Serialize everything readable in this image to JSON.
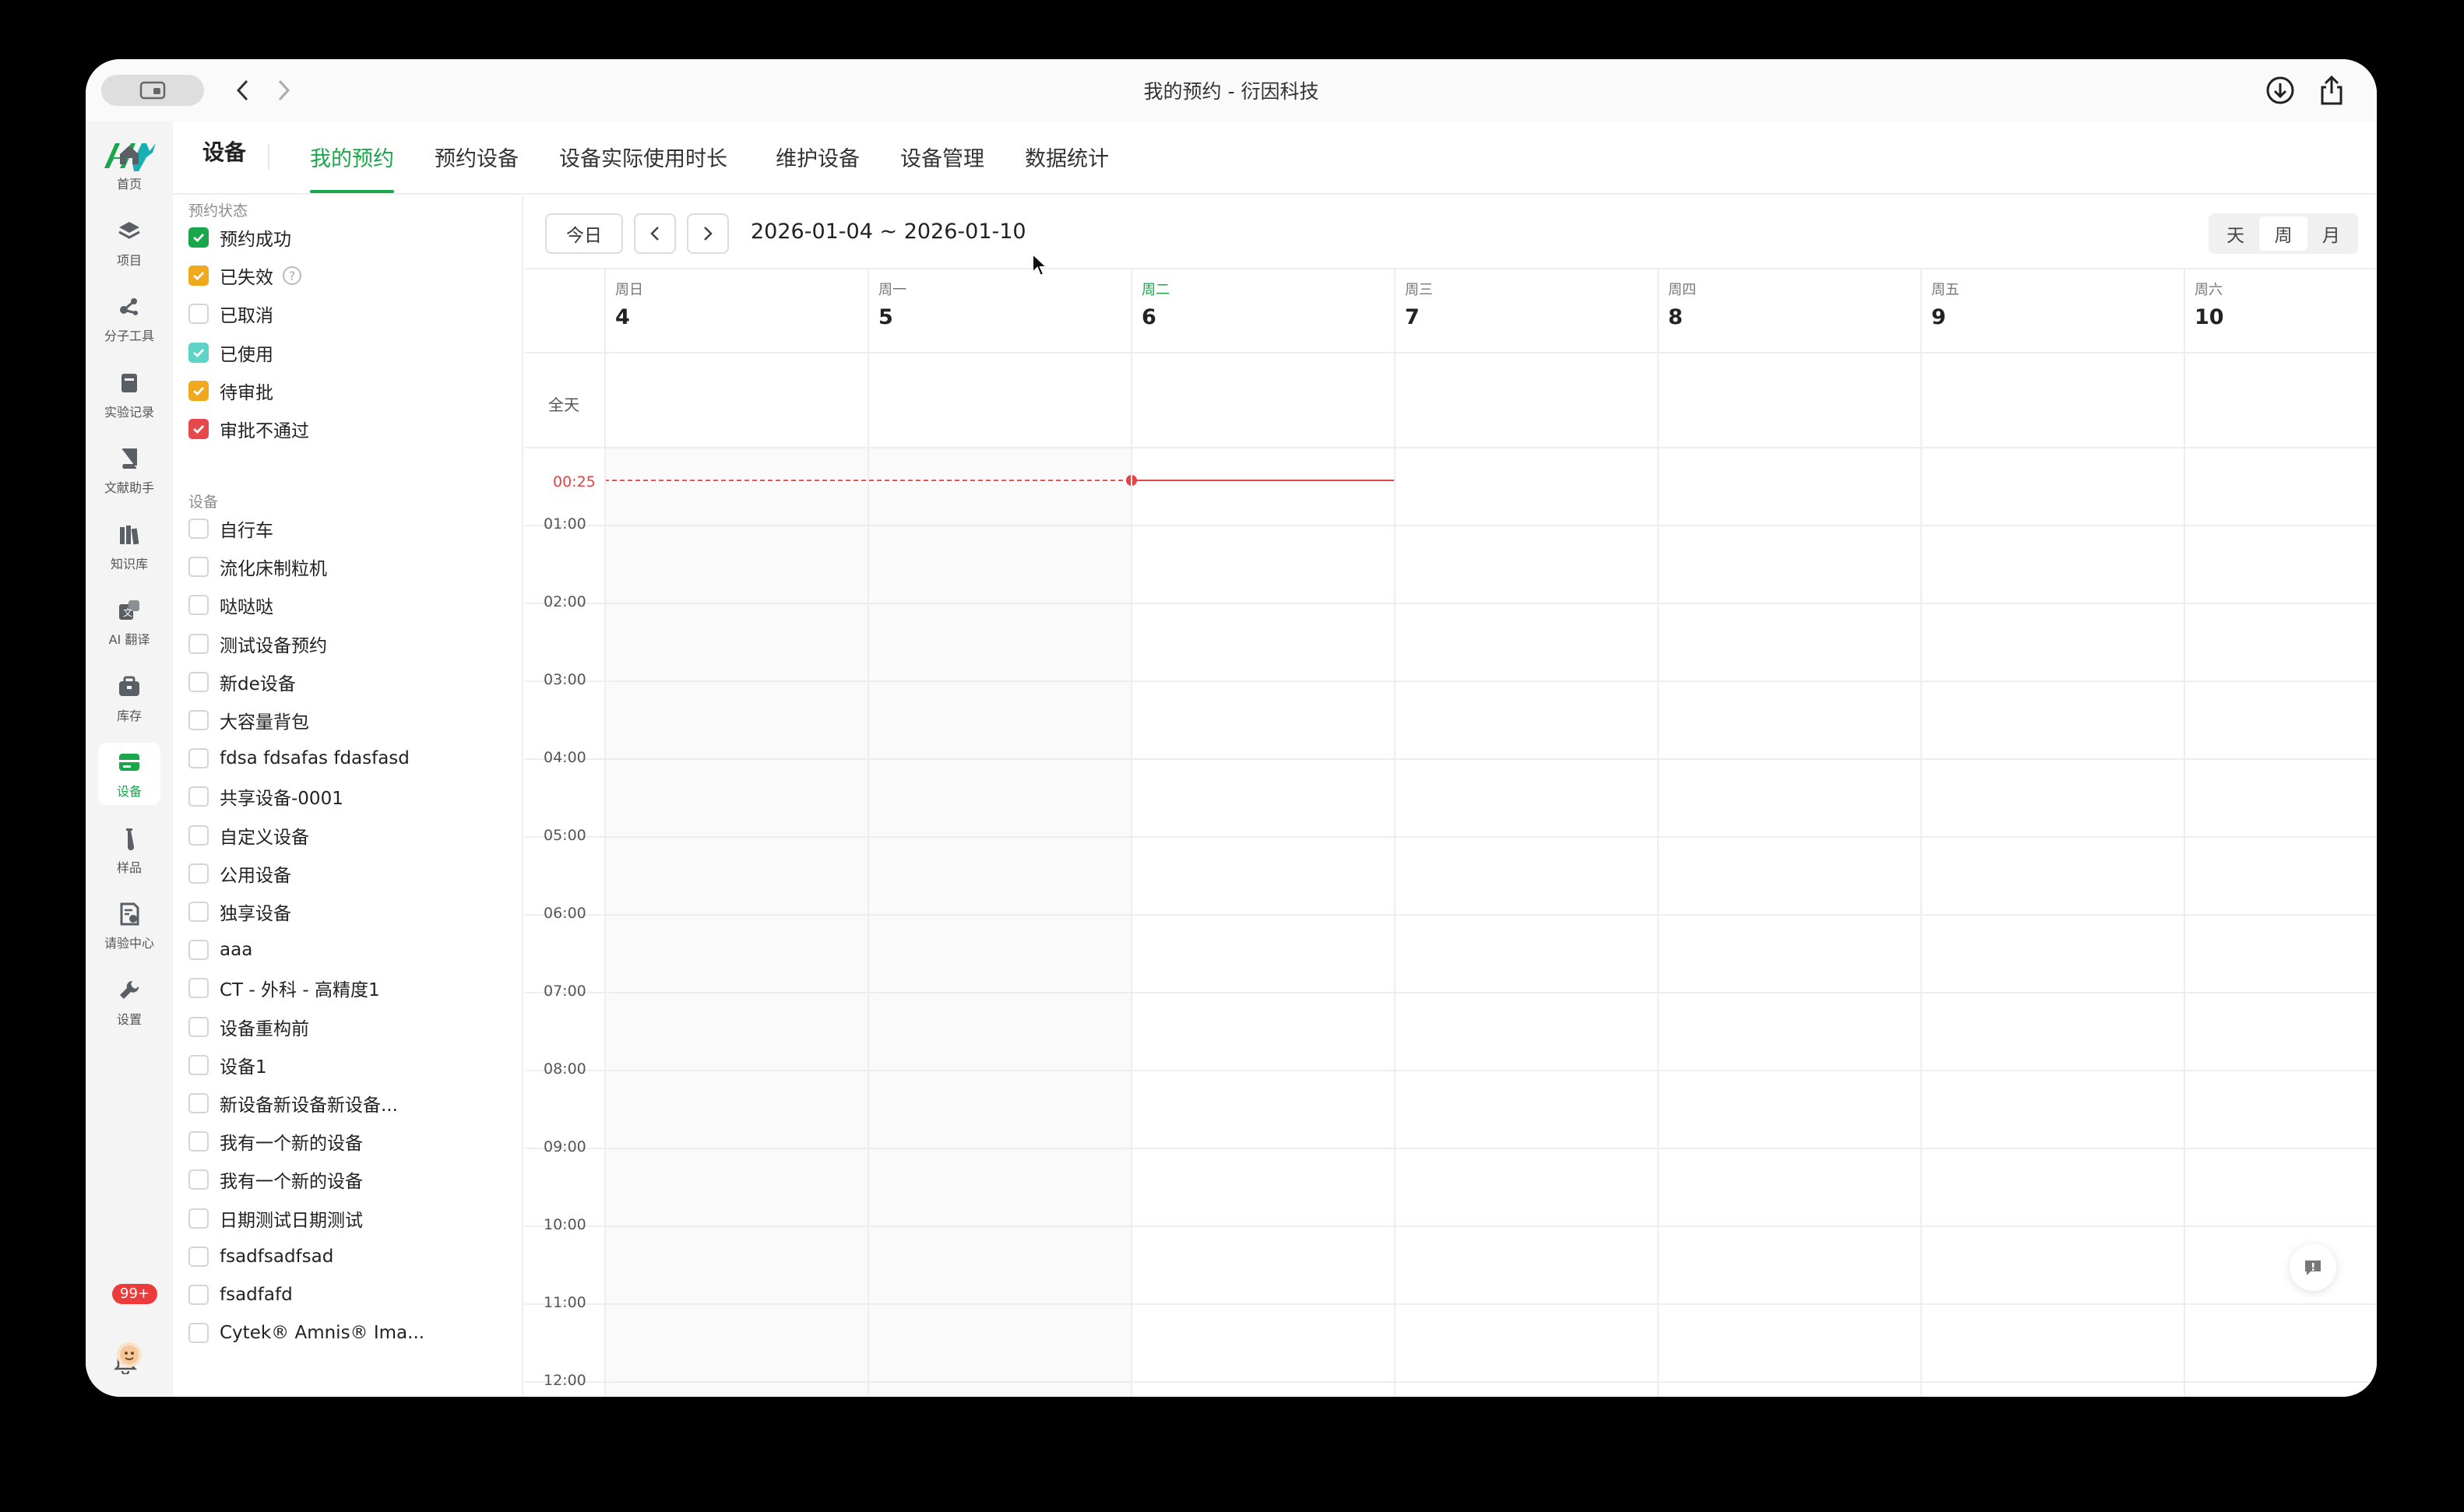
{
  "window_title": "我的预约 - 衍因科技",
  "sidebar": {
    "items": [
      {
        "label": "首页",
        "icon": "home-icon"
      },
      {
        "label": "项目",
        "icon": "layers-icon"
      },
      {
        "label": "分子工具",
        "icon": "molecule-icon"
      },
      {
        "label": "实验记录",
        "icon": "notebook-icon"
      },
      {
        "label": "文献助手",
        "icon": "book-icon"
      },
      {
        "label": "知识库",
        "icon": "library-icon"
      },
      {
        "label": "AI 翻译",
        "icon": "translate-icon"
      },
      {
        "label": "库存",
        "icon": "inventory-icon"
      },
      {
        "label": "设备",
        "icon": "device-icon",
        "active": true
      },
      {
        "label": "样品",
        "icon": "sample-icon"
      },
      {
        "label": "请验中心",
        "icon": "request-icon"
      },
      {
        "label": "设置",
        "icon": "settings-icon"
      }
    ],
    "notification_badge": "99+"
  },
  "tabs": {
    "main": "设备",
    "items": [
      "我的预约",
      "预约设备",
      "设备实际使用时长",
      "维护设备",
      "设备管理",
      "数据统计"
    ],
    "active": "我的预约"
  },
  "filter": {
    "status_title": "预约状态",
    "statuses": [
      {
        "label": "预约成功",
        "checked": true,
        "color": "#1aa64a"
      },
      {
        "label": "已失效",
        "checked": true,
        "color": "#f0a81c",
        "help": "?"
      },
      {
        "label": "已取消",
        "checked": false,
        "color": "#d5d5d5"
      },
      {
        "label": "已使用",
        "checked": true,
        "color": "#5fd3c8"
      },
      {
        "label": "待审批",
        "checked": true,
        "color": "#f0a81c"
      },
      {
        "label": "审批不通过",
        "checked": true,
        "color": "#e5484d"
      }
    ],
    "device_title": "设备",
    "devices": [
      "自行车",
      "流化床制粒机",
      "哒哒哒",
      "测试设备预约",
      "新de设备",
      "大容量背包",
      "fdsa fdsafas fdasfasd",
      "共享设备-0001",
      "自定义设备",
      "公用设备",
      "独享设备",
      "aaa",
      "CT - 外科 - 高精度1",
      "设备重构前",
      "设备1",
      "新设备新设备新设备...",
      "我有一个新的设备",
      "我有一个新的设备",
      "日期测试日期测试",
      "fsadfsadfsad",
      "fsadfafd",
      "Cytek® Amnis® Ima..."
    ]
  },
  "calendar": {
    "today_button": "今日",
    "range": "2026-01-04 ~ 2026-01-10",
    "views": [
      "天",
      "周",
      "月"
    ],
    "active_view": "周",
    "days": [
      {
        "weekday": "周日",
        "day": "4"
      },
      {
        "weekday": "周一",
        "day": "5"
      },
      {
        "weekday": "周二",
        "day": "6",
        "today": true
      },
      {
        "weekday": "周三",
        "day": "7"
      },
      {
        "weekday": "周四",
        "day": "8"
      },
      {
        "weekday": "周五",
        "day": "9"
      },
      {
        "weekday": "周六",
        "day": "10"
      }
    ],
    "all_day_label": "全天",
    "current_time": "00:25",
    "hours": [
      "01:00",
      "02:00",
      "03:00",
      "04:00",
      "05:00",
      "06:00",
      "07:00",
      "08:00",
      "09:00",
      "10:00",
      "11:00",
      "12:00"
    ],
    "accent_color": "#1aa64a",
    "now_color": "#e04545"
  }
}
